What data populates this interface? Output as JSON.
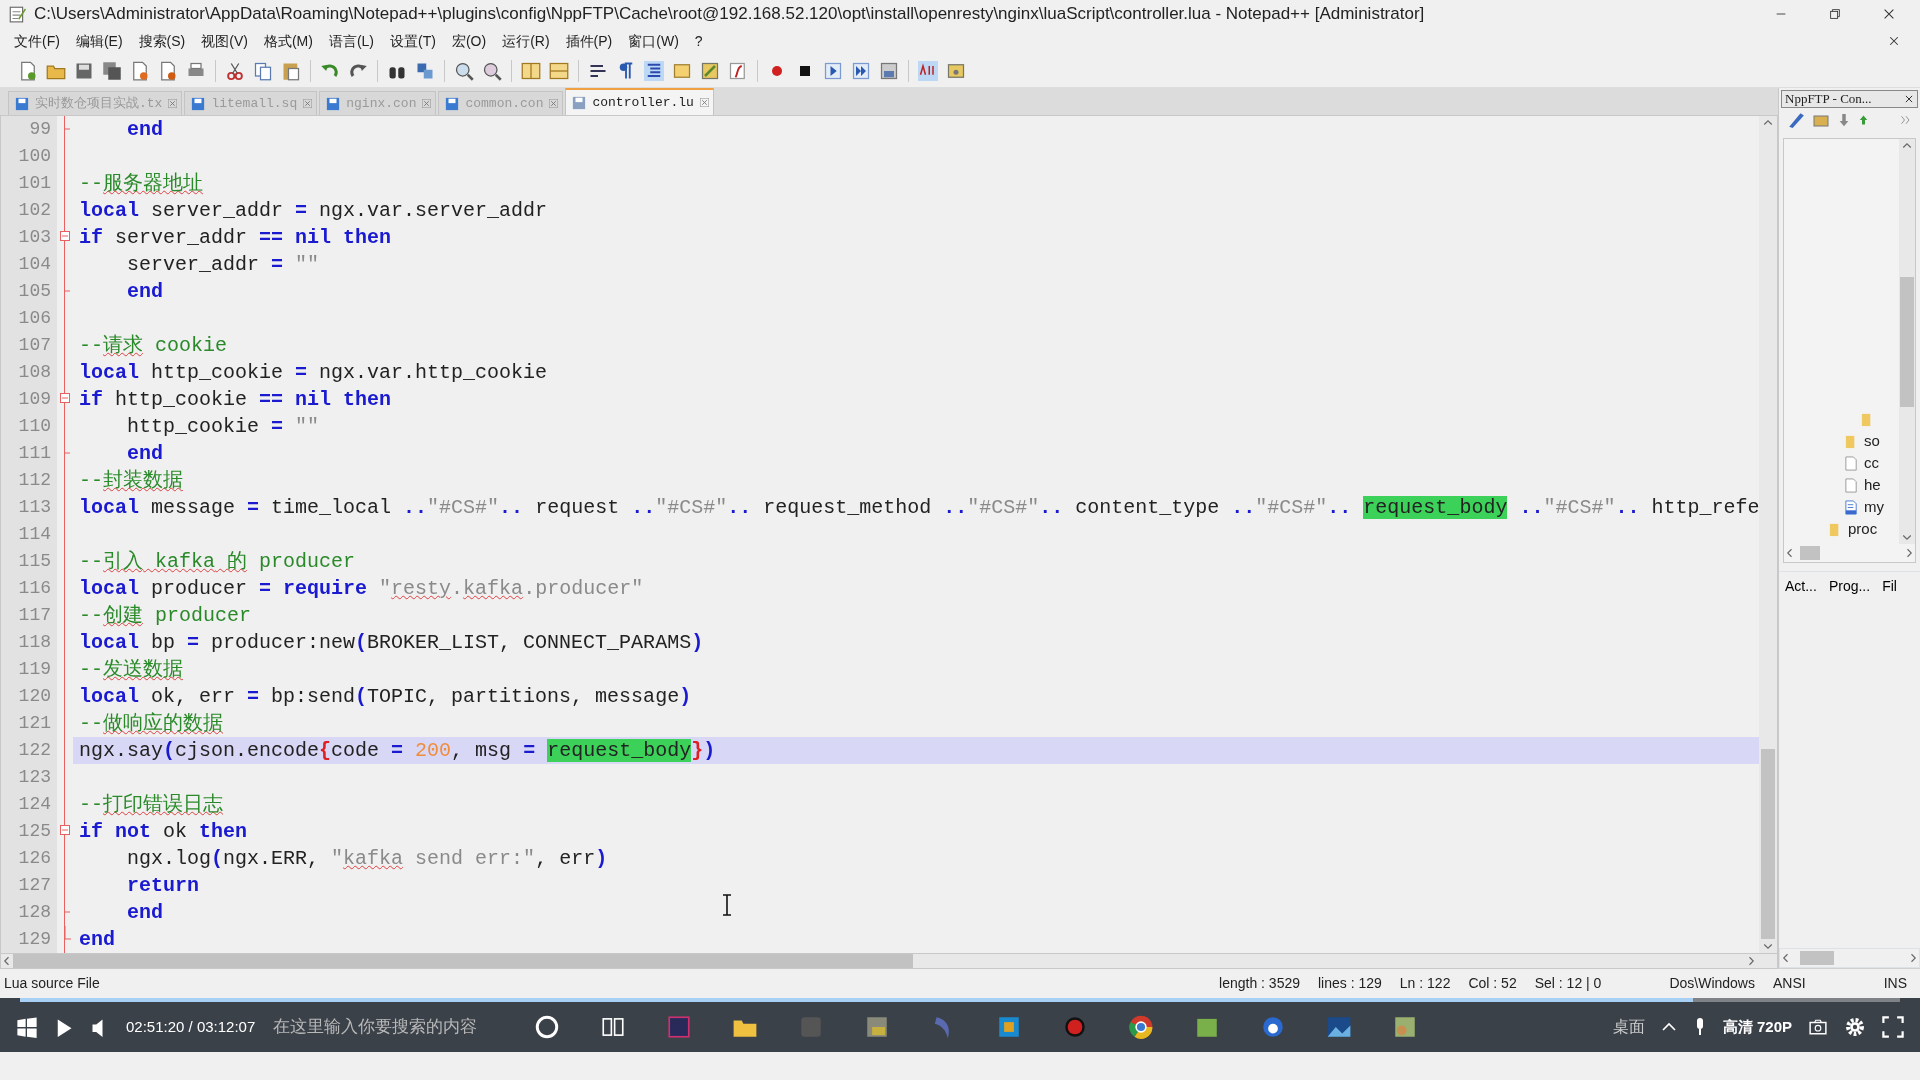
{
  "window": {
    "title": "C:\\Users\\Administrator\\AppData\\Roaming\\Notepad++\\plugins\\config\\NppFTP\\Cache\\root@192.168.52.120\\opt\\install\\openresty\\nginx\\luaScript\\controller.lua - Notepad++ [Administrator]"
  },
  "menu": [
    "文件(F)",
    "编辑(E)",
    "搜索(S)",
    "视图(V)",
    "格式(M)",
    "语言(L)",
    "设置(T)",
    "宏(O)",
    "运行(R)",
    "插件(P)",
    "窗口(W)",
    "?"
  ],
  "tabs": [
    {
      "label": "实时数仓项目实战.tx",
      "selected": false
    },
    {
      "label": "litemall.sq",
      "selected": false
    },
    {
      "label": "nginx.con",
      "selected": false
    },
    {
      "label": "common.con",
      "selected": false
    },
    {
      "label": "controller.lu",
      "selected": true
    }
  ],
  "lines": [
    {
      "no": "99",
      "kind": "end",
      "current": false,
      "tokens": [
        {
          "kind": "keyword",
          "text": "    end"
        }
      ]
    },
    {
      "no": "100",
      "kind": "plain",
      "current": false
    },
    {
      "no": "101",
      "kind": "plain",
      "current": false,
      "tokens": [
        {
          "kind": "comment",
          "text": "--"
        },
        {
          "kind": "flagged",
          "text": "服务器地址"
        }
      ]
    },
    {
      "no": "102",
      "kind": "plain",
      "current": false,
      "tokens": [
        {
          "kind": "keyword",
          "text": "local"
        },
        {
          "kind": "plain",
          "text": " server_addr "
        },
        {
          "kind": "operator",
          "text": "="
        },
        {
          "kind": "plain",
          "text": " ngx.var.server_addr"
        }
      ]
    },
    {
      "no": "103",
      "kind": "open",
      "current": false,
      "tokens": [
        {
          "kind": "keyword",
          "text": "if"
        },
        {
          "kind": "plain",
          "text": " server_addr "
        },
        {
          "kind": "operator",
          "text": "=="
        },
        {
          "kind": "keyword",
          "text": " nil"
        },
        {
          "kind": "keyword",
          "text": " then"
        }
      ]
    },
    {
      "no": "104",
      "kind": "plain",
      "current": false,
      "tokens": [
        {
          "kind": "plain",
          "text": "    server_addr "
        },
        {
          "kind": "operator",
          "text": "="
        },
        {
          "kind": "string",
          "text": " \"\""
        }
      ]
    },
    {
      "no": "105",
      "kind": "end",
      "current": false,
      "tokens": [
        {
          "kind": "keyword",
          "text": "    end"
        }
      ]
    },
    {
      "no": "106",
      "kind": "plain",
      "current": false
    },
    {
      "no": "107",
      "kind": "plain",
      "current": false,
      "tokens": [
        {
          "kind": "comment",
          "text": "--"
        },
        {
          "kind": "flagged",
          "text": "请求"
        },
        {
          "kind": "comment",
          "text": " cookie"
        }
      ]
    },
    {
      "no": "108",
      "kind": "plain",
      "current": false,
      "tokens": [
        {
          "kind": "keyword",
          "text": "local"
        },
        {
          "kind": "plain",
          "text": " http_cookie "
        },
        {
          "kind": "operator",
          "text": "="
        },
        {
          "kind": "plain",
          "text": " ngx.var.http_cookie"
        }
      ]
    },
    {
      "no": "109",
      "kind": "open",
      "current": false,
      "tokens": [
        {
          "kind": "keyword",
          "text": "if"
        },
        {
          "kind": "plain",
          "text": " http_cookie "
        },
        {
          "kind": "operator",
          "text": "=="
        },
        {
          "kind": "keyword",
          "text": " nil"
        },
        {
          "kind": "keyword",
          "text": " then"
        }
      ]
    },
    {
      "no": "110",
      "kind": "plain",
      "current": false,
      "tokens": [
        {
          "kind": "plain",
          "text": "    http_cookie "
        },
        {
          "kind": "operator",
          "text": "="
        },
        {
          "kind": "string",
          "text": " \"\""
        }
      ]
    },
    {
      "no": "111",
      "kind": "end",
      "current": false,
      "tokens": [
        {
          "kind": "keyword",
          "text": "    end"
        }
      ]
    },
    {
      "no": "112",
      "kind": "plain",
      "current": false,
      "tokens": [
        {
          "kind": "comment",
          "text": "--"
        },
        {
          "kind": "flagged",
          "text": "封装数据"
        }
      ]
    },
    {
      "no": "113",
      "kind": "plain",
      "current": false,
      "tokens": [
        {
          "kind": "keyword",
          "text": "local"
        },
        {
          "kind": "plain",
          "text": " message "
        },
        {
          "kind": "operator",
          "text": "="
        },
        {
          "kind": "plain",
          "text": " time_local "
        },
        {
          "kind": "operator",
          "text": ".."
        },
        {
          "kind": "string",
          "text": "\"#CS#\""
        },
        {
          "kind": "operator",
          "text": ".."
        },
        {
          "kind": "plain",
          "text": " request "
        },
        {
          "kind": "operator",
          "text": ".."
        },
        {
          "kind": "string",
          "text": "\"#CS#\""
        },
        {
          "kind": "operator",
          "text": ".."
        },
        {
          "kind": "plain",
          "text": " request_method "
        },
        {
          "kind": "operator",
          "text": ".."
        },
        {
          "kind": "string",
          "text": "\"#CS#\""
        },
        {
          "kind": "operator",
          "text": ".."
        },
        {
          "kind": "plain",
          "text": " content_type "
        },
        {
          "kind": "operator",
          "text": ".."
        },
        {
          "kind": "string",
          "text": "\"#CS#\""
        },
        {
          "kind": "operator",
          "text": ".. "
        },
        {
          "kind": "match",
          "text": "request_body"
        },
        {
          "kind": "operator",
          "text": " .."
        },
        {
          "kind": "string",
          "text": "\"#CS#\""
        },
        {
          "kind": "operator",
          "text": ".."
        },
        {
          "kind": "plain",
          "text": " http_refe"
        }
      ]
    },
    {
      "no": "114",
      "kind": "plain",
      "current": false
    },
    {
      "no": "115",
      "kind": "plain",
      "current": false,
      "tokens": [
        {
          "kind": "comment",
          "text": "--"
        },
        {
          "kind": "flagged",
          "text": "引入"
        },
        {
          "kind": "flagged",
          "text": " kafka"
        },
        {
          "kind": "flagged",
          "text": " 的"
        },
        {
          "kind": "comment",
          "text": " producer"
        }
      ]
    },
    {
      "no": "116",
      "kind": "plain",
      "current": false,
      "tokens": [
        {
          "kind": "keyword",
          "text": "local"
        },
        {
          "kind": "plain",
          "text": " producer "
        },
        {
          "kind": "operator",
          "text": "="
        },
        {
          "kind": "keyword",
          "text": " require"
        },
        {
          "kind": "string",
          "text": " \""
        },
        {
          "kind": "flaggedstring",
          "text": "resty"
        },
        {
          "kind": "string",
          "text": "."
        },
        {
          "kind": "flaggedstring",
          "text": "kafka"
        },
        {
          "kind": "string",
          "text": ".producer\""
        }
      ]
    },
    {
      "no": "117",
      "kind": "plain",
      "current": false,
      "tokens": [
        {
          "kind": "comment",
          "text": "--"
        },
        {
          "kind": "flagged",
          "text": "创建"
        },
        {
          "kind": "comment",
          "text": " producer"
        }
      ]
    },
    {
      "no": "118",
      "kind": "plain",
      "current": false,
      "tokens": [
        {
          "kind": "keyword",
          "text": "local"
        },
        {
          "kind": "plain",
          "text": " bp "
        },
        {
          "kind": "operator",
          "text": "="
        },
        {
          "kind": "plain",
          "text": " producer:new"
        },
        {
          "kind": "operator",
          "text": "("
        },
        {
          "kind": "plain",
          "text": "BROKER_LIST, CONNECT_PARAMS"
        },
        {
          "kind": "operator",
          "text": ")"
        }
      ]
    },
    {
      "no": "119",
      "kind": "plain",
      "current": false,
      "tokens": [
        {
          "kind": "comment",
          "text": "--"
        },
        {
          "kind": "flagged",
          "text": "发送数据"
        }
      ]
    },
    {
      "no": "120",
      "kind": "plain",
      "current": false,
      "tokens": [
        {
          "kind": "keyword",
          "text": "local"
        },
        {
          "kind": "plain",
          "text": " ok, err "
        },
        {
          "kind": "operator",
          "text": "="
        },
        {
          "kind": "plain",
          "text": " bp:send"
        },
        {
          "kind": "operator",
          "text": "("
        },
        {
          "kind": "plain",
          "text": "TOPIC, partitions, message"
        },
        {
          "kind": "operator",
          "text": ")"
        }
      ]
    },
    {
      "no": "121",
      "kind": "plain",
      "current": false,
      "tokens": [
        {
          "kind": "comment",
          "text": "--"
        },
        {
          "kind": "flagged",
          "text": "做响应的数据"
        }
      ]
    },
    {
      "no": "122",
      "kind": "plain",
      "current": true,
      "tokens": [
        {
          "kind": "plain",
          "text": "ngx.say"
        },
        {
          "kind": "operator",
          "text": "("
        },
        {
          "kind": "plain",
          "text": "cjson.encode"
        },
        {
          "kind": "brace",
          "text": "{"
        },
        {
          "kind": "plain",
          "text": "code "
        },
        {
          "kind": "operator",
          "text": "="
        },
        {
          "kind": "number",
          "text": " 200"
        },
        {
          "kind": "plain",
          "text": ", msg "
        },
        {
          "kind": "operator",
          "text": "= "
        },
        {
          "kind": "match",
          "text": "request_body"
        },
        {
          "kind": "brace",
          "text": "}"
        },
        {
          "kind": "operator",
          "text": ")"
        }
      ]
    },
    {
      "no": "123",
      "kind": "plain",
      "current": false
    },
    {
      "no": "124",
      "kind": "plain",
      "current": false,
      "tokens": [
        {
          "kind": "comment",
          "text": "--"
        },
        {
          "kind": "flagged",
          "text": "打印错误日志"
        }
      ]
    },
    {
      "no": "125",
      "kind": "open",
      "current": false,
      "tokens": [
        {
          "kind": "keyword",
          "text": "if"
        },
        {
          "kind": "keyword",
          "text": " not"
        },
        {
          "kind": "plain",
          "text": " ok "
        },
        {
          "kind": "keyword",
          "text": "then"
        }
      ]
    },
    {
      "no": "126",
      "kind": "plain",
      "current": false,
      "tokens": [
        {
          "kind": "plain",
          "text": "    ngx.log"
        },
        {
          "kind": "operator",
          "text": "("
        },
        {
          "kind": "plain",
          "text": "ngx.ERR, "
        },
        {
          "kind": "string",
          "text": "\""
        },
        {
          "kind": "flaggedstring",
          "text": "kafka"
        },
        {
          "kind": "string",
          "text": " send err:\""
        },
        {
          "kind": "plain",
          "text": ", err"
        },
        {
          "kind": "operator",
          "text": ")"
        }
      ]
    },
    {
      "no": "127",
      "kind": "plain",
      "current": false,
      "tokens": [
        {
          "kind": "keyword",
          "text": "    return"
        }
      ]
    },
    {
      "no": "128",
      "kind": "end",
      "current": false,
      "tokens": [
        {
          "kind": "keyword",
          "text": "    end"
        }
      ]
    },
    {
      "no": "129",
      "kind": "close",
      "current": false,
      "tokens": [
        {
          "kind": "keyword",
          "text": "end"
        }
      ]
    }
  ],
  "panel": {
    "title": "NppFTP - Con...",
    "tree": [
      {
        "kind": "branch",
        "children": [
          {
            "kind": "branch",
            "children": [
              {
                "kind": "folder"
              }
            ]
          },
          {
            "kind": "folder",
            "label": "so"
          },
          {
            "kind": "file",
            "label": "cc"
          },
          {
            "kind": "file",
            "label": "he"
          },
          {
            "kind": "script",
            "label": "my"
          }
        ]
      },
      {
        "kind": "folder",
        "label": "proc"
      }
    ],
    "tabs": [
      "Act...",
      "Prog...",
      "Fil"
    ]
  },
  "status_bar": {
    "file_type": "Lua source File",
    "fields": [
      "length : 3529",
      "lines : 129",
      "Ln : 122",
      "Col : 52",
      "Sel : 12 | 0",
      "Dos\\Windows",
      "ANSI",
      "INS"
    ]
  },
  "taskbar": {
    "search": {
      "placeholder": "在这里输入你要搜索的内容"
    },
    "desktop_label": "桌面"
  },
  "player": {
    "time": "02:51:20 / 03:12:07",
    "quality": "高清 720P",
    "level": 0.89
  }
}
